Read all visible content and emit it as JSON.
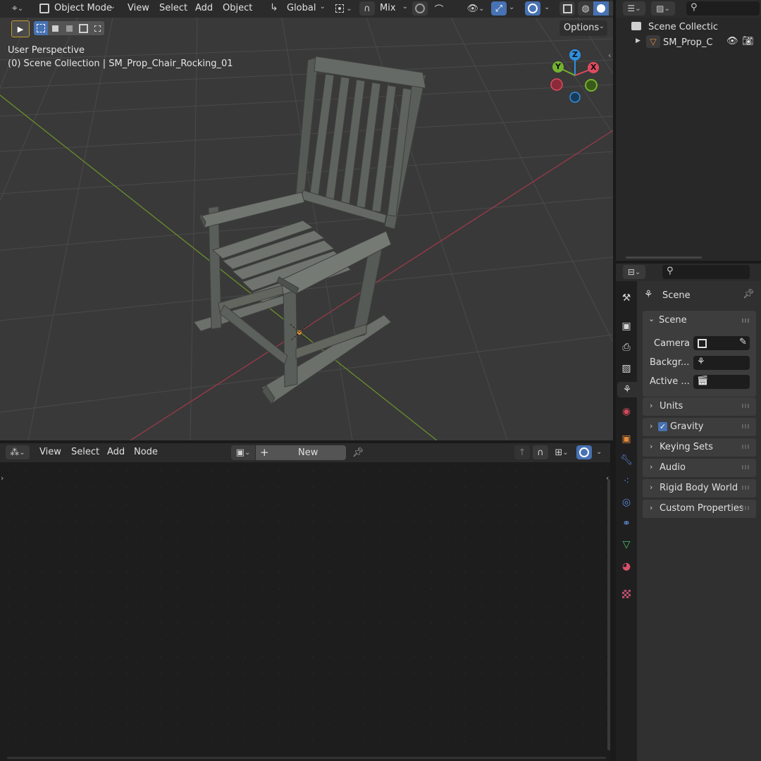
{
  "viewport_header": {
    "mode": "Object Mode",
    "menus": [
      "View",
      "Select",
      "Add",
      "Object"
    ],
    "transform_orientation": "Global",
    "snap_mode": "Mix",
    "options_label": "Options"
  },
  "viewport": {
    "perspective_label": "User Perspective",
    "collection_label": "(0) Scene Collection | SM_Prop_Chair_Rocking_01",
    "gizmo": {
      "x": "X",
      "y": "Y",
      "z": "Z"
    }
  },
  "outliner": {
    "root": "Scene Collectic",
    "object": "SM_Prop_C"
  },
  "properties": {
    "context": "Scene",
    "panel_title": "Scene",
    "camera_label": "Camera",
    "background_label": "Backgr...",
    "active_label": "Active ...",
    "sections": [
      {
        "label": "Units"
      },
      {
        "label": "Gravity",
        "checked": true
      },
      {
        "label": "Keying Sets"
      },
      {
        "label": "Audio"
      },
      {
        "label": "Rigid Body World"
      },
      {
        "label": "Custom Properties"
      }
    ]
  },
  "node_editor": {
    "menus": [
      "View",
      "Select",
      "Add",
      "Node"
    ],
    "new_label": "New"
  },
  "colors": {
    "accent_blue": "#4772b3",
    "x_axis": "#e04a5f",
    "y_axis": "#74b32d",
    "z_axis": "#2f8fe0"
  }
}
